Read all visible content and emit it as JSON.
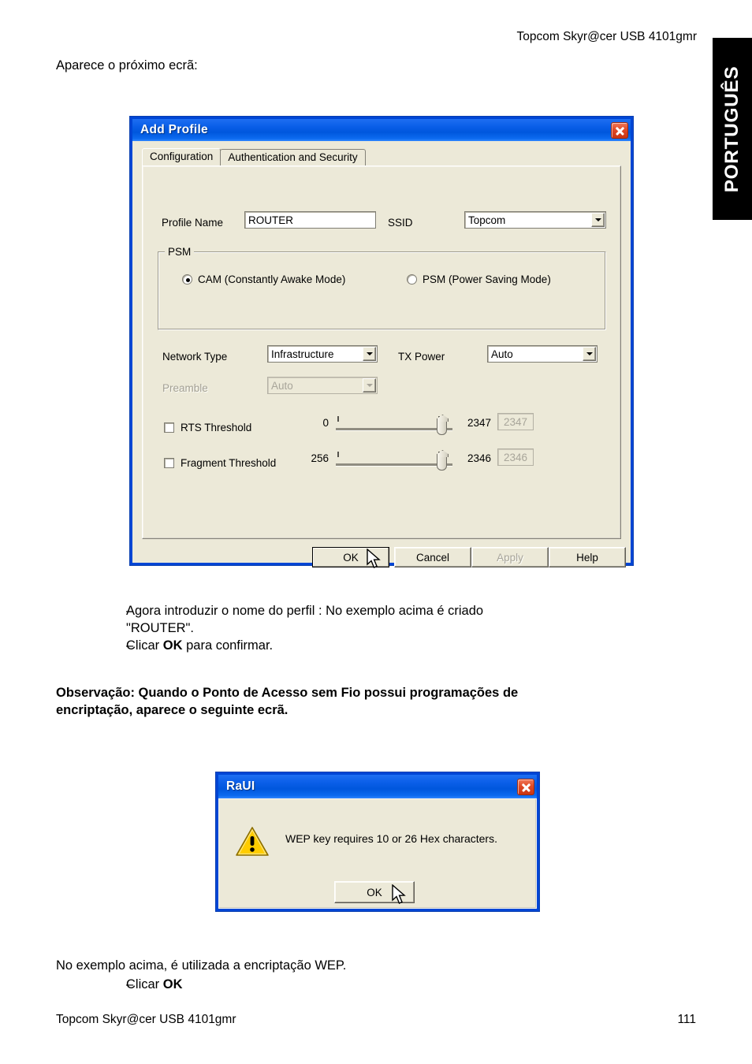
{
  "page": {
    "header_right": "Topcom Skyr@cer USB 4101gmr",
    "lang_tab": "PORTUGUÊS",
    "intro": "Aparece o próximo ecrã:",
    "bullets": [
      {
        "dash": "–",
        "line1": "Agora introduzir o nome do perfil : No exemplo acima é criado",
        "line2": "\"ROUTER\"."
      },
      {
        "dash": "–",
        "line1": "Clicar OK para confirmar.",
        "line2": ""
      }
    ],
    "bullet2_prefix": "Clicar ",
    "bullet2_bold": "OK",
    "bullet2_suffix": " para confirmar.",
    "note_line1": "Observação: Quando o Ponto de Acesso sem Fio possui programações de",
    "note_line2": "encriptação, aparece o seguinte ecrã.",
    "closing_line": "No exemplo acima, é utilizada a encriptação WEP.",
    "closing_dash": "–",
    "closing_bullet_prefix": "Clicar ",
    "closing_bullet_bold": "OK",
    "footer_left": "Topcom Skyr@cer USB 4101gmr",
    "footer_page": "111"
  },
  "add_profile_dialog": {
    "title": "Add Profile",
    "close_icon": "close-icon",
    "tabs": [
      {
        "label": "Configuration",
        "active": true
      },
      {
        "label": "Authentication and Security",
        "active": false
      }
    ],
    "fields": {
      "profile_name_label": "Profile Name",
      "profile_name_value": "ROUTER",
      "ssid_label": "SSID",
      "ssid_value": "Topcom",
      "network_type_label": "Network Type",
      "network_type_value": "Infrastructure",
      "tx_power_label": "TX Power",
      "tx_power_value": "Auto",
      "preamble_label": "Preamble",
      "preamble_value": "Auto"
    },
    "psm_group": {
      "title": "PSM",
      "options": [
        {
          "label": "CAM (Constantly Awake Mode)",
          "selected": true
        },
        {
          "label": "PSM (Power Saving Mode)",
          "selected": false
        }
      ]
    },
    "thresholds": [
      {
        "label": "RTS Threshold",
        "checked": false,
        "min": "0",
        "max": "2347",
        "value": "2347",
        "thumb_pct": 96
      },
      {
        "label": "Fragment Threshold",
        "checked": false,
        "min": "256",
        "max": "2346",
        "value": "2346",
        "thumb_pct": 96
      }
    ],
    "buttons": [
      {
        "label": "OK",
        "state": "default"
      },
      {
        "label": "Cancel",
        "state": "normal"
      },
      {
        "label": "Apply",
        "state": "disabled"
      },
      {
        "label": "Help",
        "state": "normal"
      }
    ]
  },
  "raui_dialog": {
    "title": "RaUI",
    "close_icon": "close-icon",
    "warning_icon": "warning-triangle-icon",
    "message": "WEP key requires 10 or 26 Hex characters.",
    "ok_label": "OK"
  },
  "colors": {
    "titlebar_blue": "#0057dd",
    "dialog_face": "#ece9d8",
    "close_red": "#c93513",
    "warning_yellow": "#ffcc00",
    "accent_border": "#0046d5"
  }
}
